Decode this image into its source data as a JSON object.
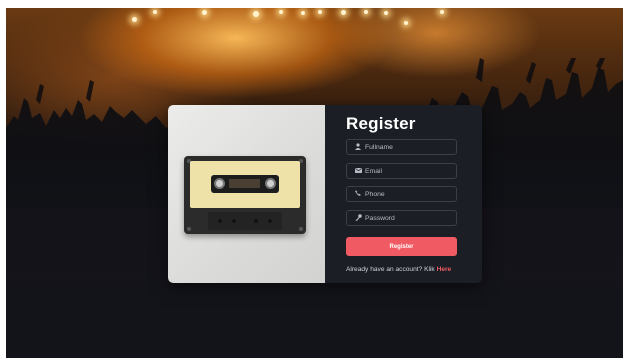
{
  "form": {
    "title": "Register",
    "fields": [
      {
        "icon": "user-icon",
        "placeholder": "Fullname",
        "value": ""
      },
      {
        "icon": "envelope-icon",
        "placeholder": "Email",
        "value": ""
      },
      {
        "icon": "phone-icon",
        "placeholder": "Phone",
        "value": ""
      },
      {
        "icon": "key-icon",
        "placeholder": "Password",
        "value": ""
      }
    ],
    "submit_label": "Register",
    "login_prompt": "Already have an account? Klik",
    "login_link": "Here",
    "accent_color": "#f05a62",
    "panel_color": "#1b1e25"
  },
  "background": {
    "description_icon": "concert-crowd"
  },
  "image": {
    "subject": "cassette-tape"
  }
}
